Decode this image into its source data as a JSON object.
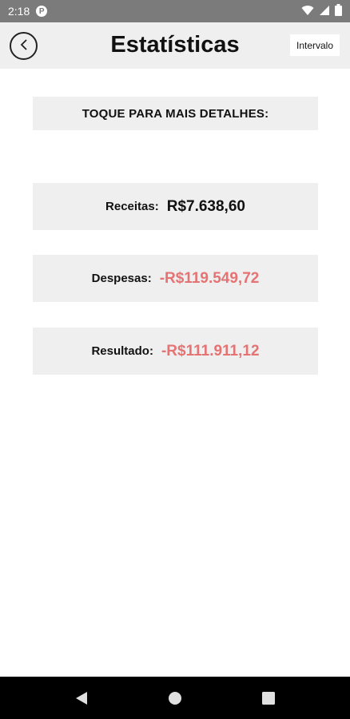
{
  "status_bar": {
    "time": "2:18",
    "app_icon": "P"
  },
  "header": {
    "title": "Estatísticas",
    "interval_label": "Intervalo"
  },
  "hint": "TOQUE PARA MAIS DETALHES:",
  "stats": [
    {
      "label": "Receitas:",
      "value": "R$7.638,60",
      "color": "#111111"
    },
    {
      "label": "Despesas:",
      "value": "-R$119.549,72",
      "color": "#e57373"
    },
    {
      "label": "Resultado:",
      "value": "-R$111.911,12",
      "color": "#e57373"
    }
  ],
  "icons": {
    "back": "back-arrow-icon",
    "wifi": "wifi-icon",
    "signal": "signal-icon",
    "battery": "battery-icon",
    "nav_back": "nav-back-icon",
    "nav_home": "nav-home-icon",
    "nav_recents": "nav-recents-icon"
  }
}
